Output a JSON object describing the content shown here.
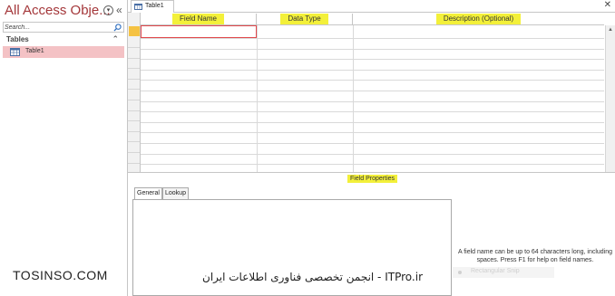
{
  "nav": {
    "title": "All Access Obje...",
    "search_placeholder": "Search...",
    "group_label": "Tables",
    "items": [
      {
        "label": "Table1"
      }
    ]
  },
  "doc": {
    "tab_label": "Table1",
    "columns": [
      "Field Name",
      "Data Type",
      "Description (Optional)"
    ],
    "field_properties_label": "Field Properties",
    "prop_tabs": [
      "General",
      "Lookup"
    ],
    "help_text": "A field name can be up to 64 characters long, including spaces. Press F1 for help on field names.",
    "ghost_label": "Rectangular Snip"
  },
  "watermarks": {
    "left": "TOSINSO.COM",
    "right": "ITPro.ir - انجمن تخصصی فناوری اطلاعات ایران"
  },
  "colors": {
    "highlight": "#f3f03a",
    "title": "#a4373a",
    "selected_item": "#f4c2c5"
  }
}
